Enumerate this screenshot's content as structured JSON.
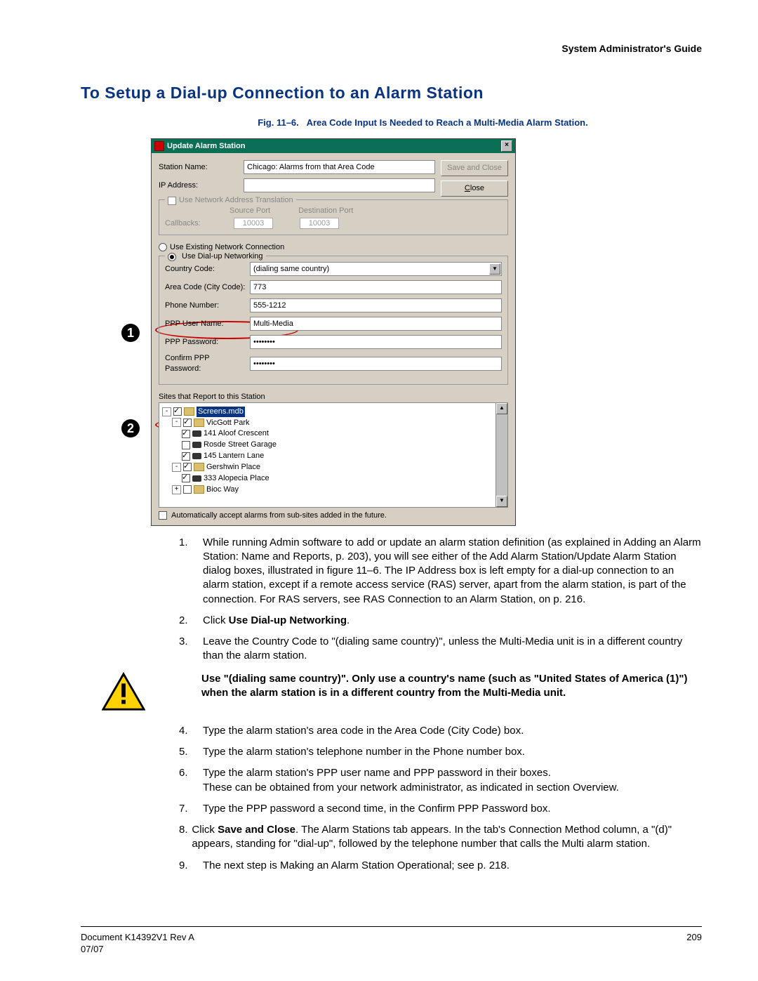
{
  "header": {
    "right": "System Administrator's Guide"
  },
  "title": "To Setup a Dial-up Connection to an Alarm Station",
  "figure": {
    "caption": "Fig. 11–6.   Area Code Input Is Needed to Reach a Multi-Media Alarm Station."
  },
  "dialog": {
    "title": "Update Alarm Station",
    "station_name_label": "Station Name:",
    "station_name_value": "Chicago: Alarms from that Area Code",
    "ip_label": "IP Address:",
    "ip_value": "",
    "save_btn": "Save and Close",
    "close_btn": "Close",
    "nat_legend": "Use Network Address Translation",
    "nat_source": "Source Port",
    "nat_dest": "Destination Port",
    "nat_callbacks": "Callbacks:",
    "nat_src_val": "10003",
    "nat_dst_val": "10003",
    "use_existing": "Use Existing Network Connection",
    "use_dialup": "Use Dial-up Networking",
    "country_label": "Country Code:",
    "country_value": "(dialing same country)",
    "area_label": "Area Code (City Code):",
    "area_value": "773",
    "phone_label": "Phone Number:",
    "phone_value": "555-1212",
    "ppp_user_label": "PPP User Name:",
    "ppp_user_value": "Multi-Media",
    "ppp_pw_label": "PPP Password:",
    "ppp_pw_value": "••••••••",
    "ppp_pw2_label": "Confirm PPP Password:",
    "ppp_pw2_value": "••••••••",
    "sites_label": "Sites that Report to this Station",
    "tree": {
      "root": "Screens.mdb",
      "n1": "VicGott Park",
      "n1a": "141 Aloof Crescent",
      "n1b": "Rosde Street Garage",
      "n1c": "145 Lantern Lane",
      "n2": "Gershwin Place",
      "n2a": "333 Alopecia Place",
      "n3": "Bioc Way"
    },
    "auto_accept": "Automatically accept alarms from sub-sites added in the future."
  },
  "callouts": {
    "one": "1",
    "two": "2"
  },
  "steps": {
    "s1": "While running Admin software to add or update an alarm station definition (as explained in Adding an Alarm Station: Name and Reports, p. 203), you will see either of the Add Alarm Station/Update Alarm Station dialog boxes, illustrated in figure 11–6. The IP Address box is left empty for a dial-up connection to an alarm station, except if a remote access service (RAS) server, apart from the alarm station, is part of the connection. For RAS servers, see RAS Connection to an Alarm Station, on p. 216.",
    "s2_a": "Click ",
    "s2_b": "Use Dial-up Networking",
    "s2_c": ".",
    "s3": "Leave the Country Code to \"(dialing same country)\", unless the Multi-Media unit is in a different country than the alarm station.",
    "warn": "Use \"(dialing same country)\". Only use a country's name (such as \"United States of America (1)\") when the alarm station is in a different country from the Multi-Media unit.",
    "s4": "Type the alarm station's area code in the Area Code (City Code) box.",
    "s5": "Type the alarm station's telephone number in the Phone number box.",
    "s6": "Type the alarm station's PPP user name and PPP password in their boxes.\nThese can be obtained from your network administrator, as indicated in section Overview.",
    "s7": "Type the PPP password a second time, in the Confirm PPP Password box.",
    "s8_a": "Click ",
    "s8_b": "Save and Close",
    "s8_c": ". The Alarm Stations tab appears. In the tab's Connection Method column, a \"(d)\" appears, standing for \"dial-up\", followed by the telephone number that calls the Multi alarm station.",
    "s9": "The next step is Making an Alarm Station Operational; see p. 218."
  },
  "footer": {
    "left1": "Document K14392V1 Rev A",
    "left2": "07/07",
    "right": "209"
  }
}
